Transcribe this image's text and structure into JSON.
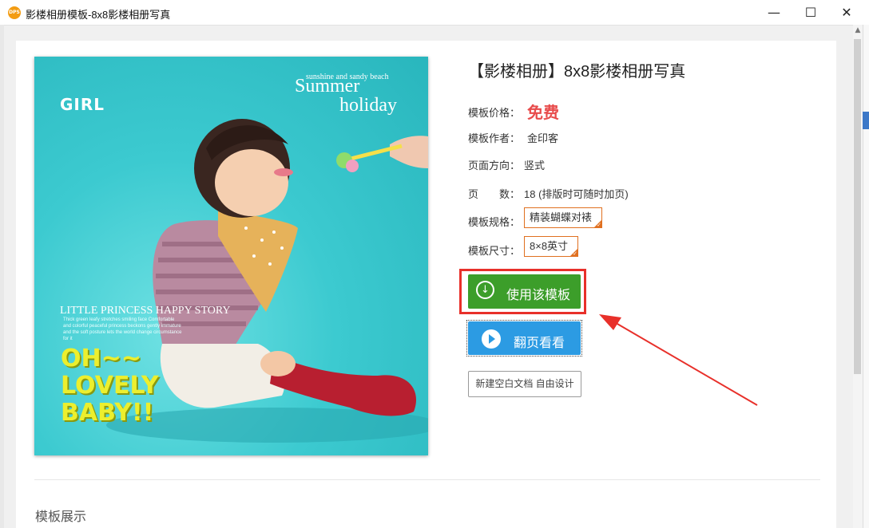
{
  "window": {
    "app_icon": "DPS",
    "title": "影楼相册模板-8x8影楼相册写真",
    "minimize": "—",
    "maximize": "☐",
    "close": "✕"
  },
  "preview": {
    "text_girl": "GIRL",
    "text_sunshine": "sunshine and sandy beach",
    "text_summer": "Summer",
    "text_holiday": "holiday",
    "text_little": "LITTLE PRINCESS HAPPY STORY",
    "text_small": "Thick green leafy stretches smiling face Comfortable and colorful peaceful princess beckons gently immature and the soft posture lets the world change circumstance for it",
    "text_oh": "OH~~\nLOVELY\nBABY!!"
  },
  "template": {
    "title": "【影楼相册】8x8影楼相册写真",
    "price_label": "模板价格：",
    "price_value": "免费",
    "author_label": "模板作者：",
    "author_value": "金印客",
    "orientation_label": "页面方向：",
    "orientation_value": "竖式",
    "pages_label": "页　　数：",
    "pages_value": "18 (排版时可随时加页)",
    "spec_label": "模板规格：",
    "spec_value": "精装蝴蝶对裱",
    "size_label": "模板尺寸：",
    "size_value": "8×8英寸"
  },
  "actions": {
    "use_label": "使用该模板",
    "flip_label": "翻页看看",
    "new_blank_label": "新建空白文档 自由设计"
  },
  "section": {
    "showcase_title": "模板展示"
  },
  "colors": {
    "accent_green": "#3c9e2a",
    "accent_blue": "#2c9be3",
    "highlight_red": "#e8302a",
    "price_red": "#e84c4c",
    "tag_orange": "#e07020"
  }
}
